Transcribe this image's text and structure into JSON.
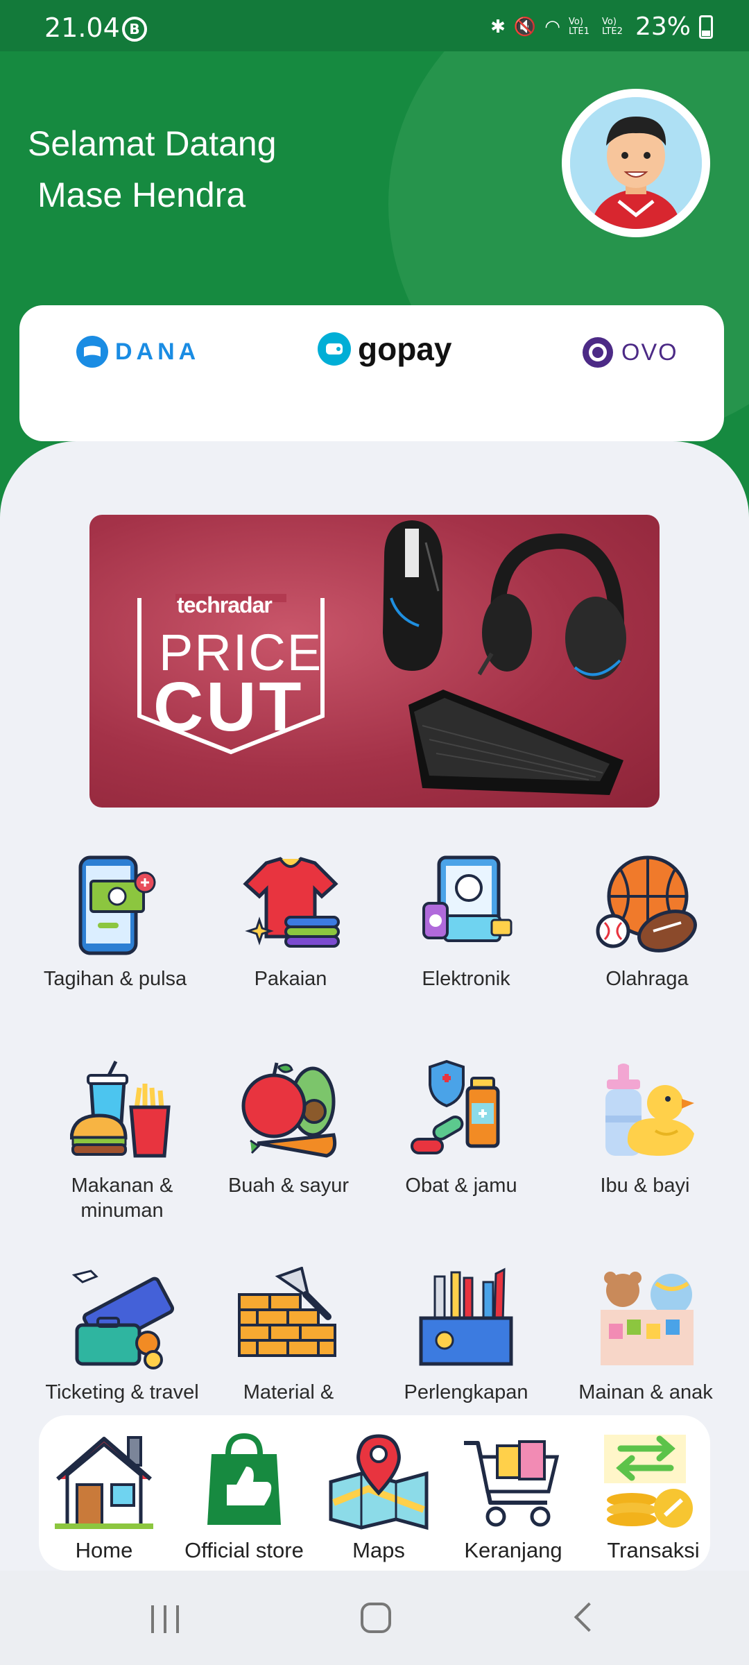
{
  "status_bar": {
    "time": "21.04",
    "b_icon_letter": "B",
    "vo_lte1": "Vo) LTE1",
    "vo_lte2": "Vo) LTE2",
    "battery": "23%"
  },
  "header": {
    "greeting_line1": "Selamat Datang",
    "greeting_line2": "Mase Hendra"
  },
  "wallets": [
    {
      "name": "DANA",
      "color": "#1a8ce3",
      "icon": "dana-logo-icon"
    },
    {
      "name": "gopay",
      "color": "#111111",
      "icon": "gopay-logo-icon"
    },
    {
      "name": "OVO",
      "color": "#4c2a86",
      "icon": "ovo-logo-icon"
    }
  ],
  "banner": {
    "brand": "techradar",
    "line1": "PRICE",
    "line2": "CUT"
  },
  "categories": [
    {
      "label": "Tagihan & pulsa",
      "icon": "phone-bill-icon"
    },
    {
      "label": "Pakaian",
      "icon": "clothes-icon"
    },
    {
      "label": "Elektronik",
      "icon": "electronics-icon"
    },
    {
      "label": "Olahraga",
      "icon": "sports-balls-icon"
    },
    {
      "label": "Makanan & minuman",
      "icon": "fast-food-icon"
    },
    {
      "label": "Buah & sayur",
      "icon": "fruit-vegetable-icon"
    },
    {
      "label": "Obat & jamu",
      "icon": "medicine-icon"
    },
    {
      "label": "Ibu & bayi",
      "icon": "baby-bottle-duck-icon"
    },
    {
      "label": "Ticketing & travel",
      "icon": "ticket-travel-icon"
    },
    {
      "label": "Material & perkakas",
      "icon": "bricks-trowel-icon"
    },
    {
      "label": "Perlengkapan ATK",
      "icon": "stationery-icon"
    },
    {
      "label": "Mainan & anak",
      "icon": "toys-icon"
    }
  ],
  "bottom_nav": [
    {
      "label": "Home",
      "icon": "home-icon"
    },
    {
      "label": "Official store",
      "icon": "shopping-bag-icon"
    },
    {
      "label": "Maps",
      "icon": "map-pin-icon"
    },
    {
      "label": "Keranjang",
      "icon": "cart-icon"
    },
    {
      "label": "Transaksi",
      "icon": "transaction-icon"
    }
  ],
  "colors": {
    "header_green": "#168a40",
    "status_green": "#137a3a",
    "background": "#eff1f6"
  }
}
